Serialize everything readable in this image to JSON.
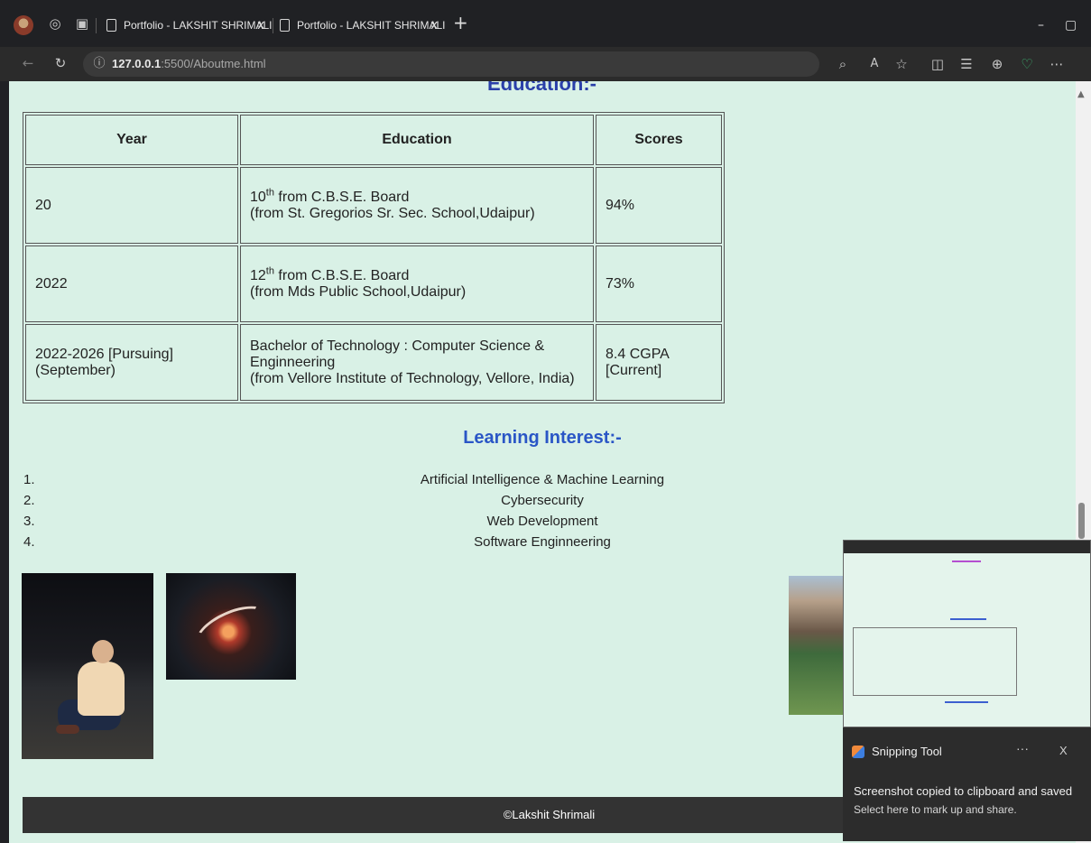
{
  "browser": {
    "tabs": [
      {
        "title": "Portfolio - LAKSHIT SHRIMALI",
        "close": "x"
      },
      {
        "title": "Portfolio - LAKSHIT SHRIMALI",
        "close": "x"
      }
    ],
    "new_tab": "+",
    "url_host": "127.0.0.1",
    "url_rest": ":5500/Aboutme.html",
    "window_minimize": "–",
    "window_restore": "▢"
  },
  "page": {
    "cut_heading": "Education:-",
    "education_table": {
      "headers": [
        "Year",
        "Education",
        "Scores"
      ],
      "rows": [
        {
          "year": "20",
          "edu_main_prefix": "10",
          "edu_main_sup": "th",
          "edu_main_suffix": " from C.B.S.E. Board",
          "edu_sub": "(from St. Gregorios Sr. Sec. School,Udaipur)",
          "score": "94%"
        },
        {
          "year": "2022",
          "edu_main_prefix": "12",
          "edu_main_sup": "th",
          "edu_main_suffix": " from C.B.S.E. Board",
          "edu_sub": "(from Mds Public School,Udaipur)",
          "score": "73%"
        },
        {
          "year": "2022-2026 [Pursuing](September)",
          "edu_main_prefix": "Bachelor of Technology : Computer Science & Enginneering",
          "edu_main_sup": "",
          "edu_main_suffix": "",
          "edu_sub": "(from Vellore Institute of Technology, Vellore, India)",
          "score": "8.4 CGPA [Current]"
        }
      ]
    },
    "learning_title": "Learning Interest:-",
    "interests": [
      {
        "num": "1.",
        "text": "Artificial Intelligence & Machine Learning"
      },
      {
        "num": "2.",
        "text": "Cybersecurity"
      },
      {
        "num": "3.",
        "text": "Web Development"
      },
      {
        "num": "4.",
        "text": "Software Enginneering"
      }
    ],
    "footer": "©Lakshit Shrimali"
  },
  "snipping_tool": {
    "app_name": "Snipping Tool",
    "more": "···",
    "close": "X",
    "message": "Screenshot copied to clipboard and saved",
    "submessage": "Select here to mark up and share."
  }
}
